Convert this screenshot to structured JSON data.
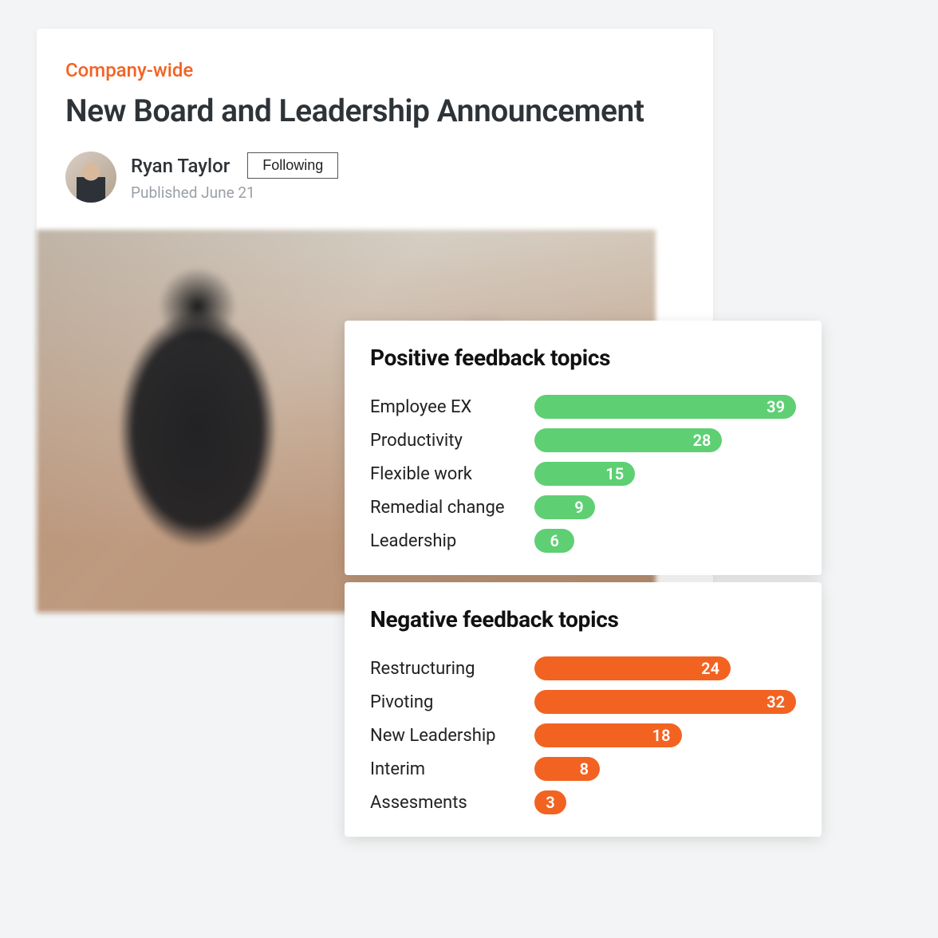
{
  "article": {
    "category": "Company-wide",
    "title": "New Board and Leadership Announcement",
    "author_name": "Ryan Taylor",
    "follow_status": "Following",
    "published": "Published June 21"
  },
  "positive": {
    "title": "Positive feedback topics",
    "items": [
      {
        "label": "Employee EX",
        "value": 39
      },
      {
        "label": "Productivity",
        "value": 28
      },
      {
        "label": "Flexible work",
        "value": 15
      },
      {
        "label": "Remedial change",
        "value": 9
      },
      {
        "label": "Leadership",
        "value": 6
      }
    ]
  },
  "negative": {
    "title": "Negative feedback topics",
    "items": [
      {
        "label": "Restructuring",
        "value": 24
      },
      {
        "label": "Pivoting",
        "value": 32
      },
      {
        "label": "New Leadership",
        "value": 18
      },
      {
        "label": "Interim",
        "value": 8
      },
      {
        "label": "Assesments",
        "value": 3
      }
    ]
  },
  "colors": {
    "accent": "#f26322",
    "positive": "#5fcf74",
    "negative": "#f26322"
  },
  "chart_data": [
    {
      "type": "bar",
      "title": "Positive feedback topics",
      "categories": [
        "Employee EX",
        "Productivity",
        "Flexible work",
        "Remedial change",
        "Leadership"
      ],
      "values": [
        39,
        28,
        15,
        9,
        6
      ],
      "orientation": "horizontal",
      "color": "#5fcf74"
    },
    {
      "type": "bar",
      "title": "Negative feedback topics",
      "categories": [
        "Restructuring",
        "Pivoting",
        "New Leadership",
        "Interim",
        "Assesments"
      ],
      "values": [
        24,
        32,
        18,
        8,
        3
      ],
      "orientation": "horizontal",
      "color": "#f26322"
    }
  ]
}
